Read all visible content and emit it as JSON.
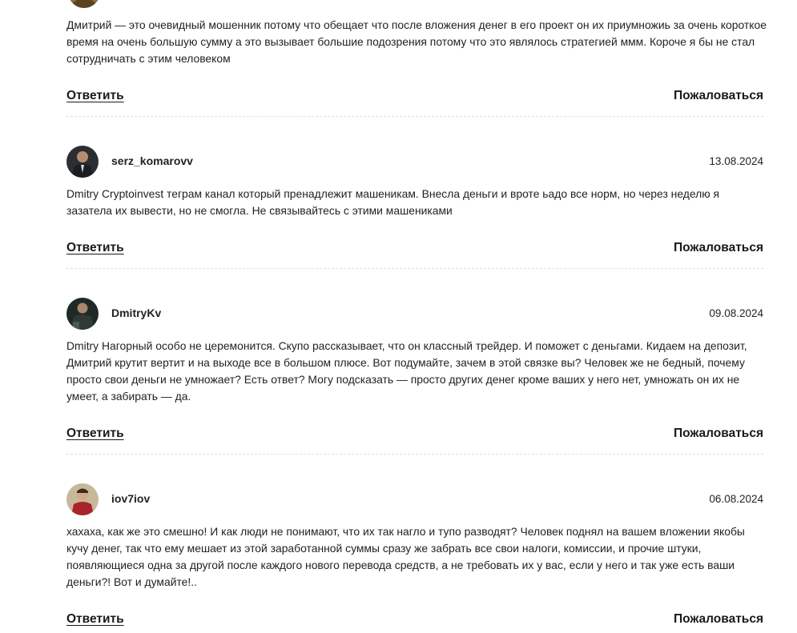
{
  "comments": [
    {
      "username": "",
      "date": "",
      "text": "Дмитрий — это очевидный мошенник потому что обещает что после вложения денег в его проект он их приумножиь за очень короткое время на очень большую сумму а это вызывает большие подозрения потому что это являлось стратегией ммм. Короче я бы не стал сотрудничать с этим человеком",
      "reply_label": "Ответить",
      "report_label": "Пожаловаться"
    },
    {
      "username": "serz_komarovv",
      "date": "13.08.2024",
      "text": "Dmitry Cryptoinvest теграм канал который пренадлежит машеникам. Внесла деньги и вроте ьадо все норм, но через неделю я зазатела их вывести, но не смогла. Не связывайтесь с этими машениками",
      "reply_label": "Ответить",
      "report_label": "Пожаловаться"
    },
    {
      "username": "DmitryKv",
      "date": "09.08.2024",
      "text": "Dmitry Нагорный особо не церемонится. Скупо рассказывает, что он классный трейдер. И поможет с деньгами. Кидаем на депозит, Дмитрий крутит вертит и на выходе все в большом плюсе. Вот подумайте, зачем в этой связке вы? Человек же не бедный, почему просто свои деньги не умножает? Есть ответ? Могу подсказать — просто других денег кроме ваших у него нет, умножать он их не умеет, а забирать — да.",
      "reply_label": "Ответить",
      "report_label": "Пожаловаться"
    },
    {
      "username": "iov7iov",
      "date": "06.08.2024",
      "text": "хахаха, как же это смешно! И как люди не понимают, что их так нагло и тупо разводят? Человек поднял на вашем вложении якобы кучу денег, так что ему мешает из этой заработанной суммы сразу же забрать все свои налоги, комиссии, и прочие штуки, появляющиеся одна за другой после каждого нового перевода средств, а не требовать их у вас, если у него и так уже есть ваши деньги?! Вот и думайте!..",
      "reply_label": "Ответить",
      "report_label": "Пожаловаться"
    }
  ],
  "colors": {
    "text": "#222222",
    "divider": "#dcdcdc",
    "background": "#ffffff"
  }
}
